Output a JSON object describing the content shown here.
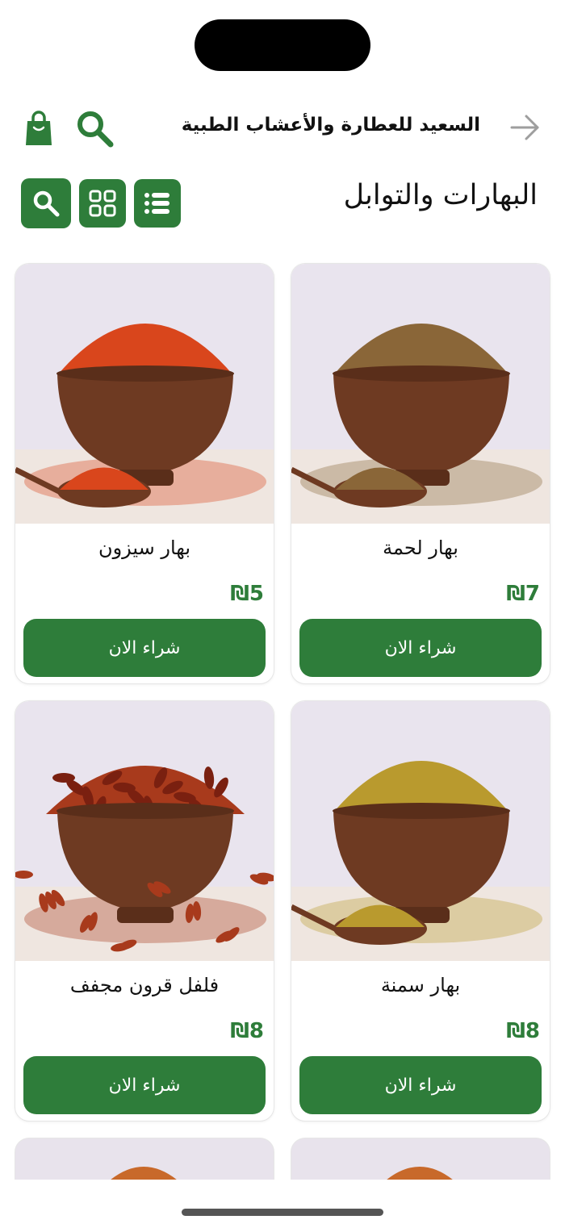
{
  "header": {
    "store_title": "السعيد للعطارة والأعشاب الطبية"
  },
  "category": {
    "title": "البهارات والتوابل"
  },
  "icons": {
    "back": "arrow-right-icon",
    "search": "search-icon",
    "bag": "shopping-bag-icon",
    "grid": "grid-view-icon",
    "list": "list-view-icon"
  },
  "colors": {
    "accent": "#2e7d3a",
    "card_bg": "#e8e3ec"
  },
  "products": [
    {
      "name": "بهار لحمة",
      "price": "₪7",
      "buy_label": "شراء الان",
      "powder_color": "#8a6638"
    },
    {
      "name": "بهار سيزون",
      "price": "₪5",
      "buy_label": "شراء الان",
      "powder_color": "#d9461c"
    },
    {
      "name": "بهار سمنة",
      "price": "₪8",
      "buy_label": "شراء الان",
      "powder_color": "#b99a2e"
    },
    {
      "name": "فلفل قرون مجفف",
      "price": "₪8",
      "buy_label": "شراء الان",
      "powder_color": "#a83a1c"
    }
  ]
}
